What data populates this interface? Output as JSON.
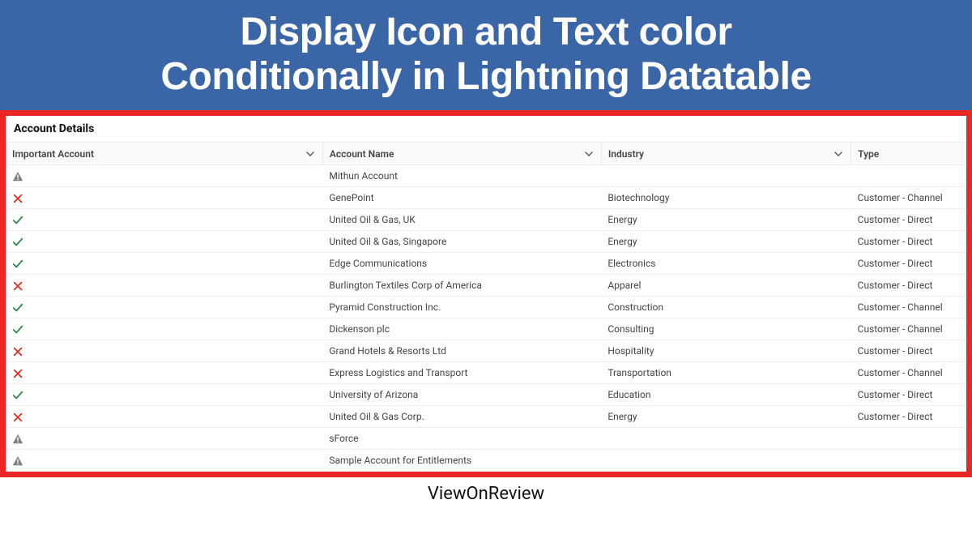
{
  "banner": {
    "title_line1": "Display Icon and Text color",
    "title_line2": "Conditionally in Lightning Datatable"
  },
  "card": {
    "title": "Account Details"
  },
  "columns": {
    "important": "Important Account",
    "name": "Account Name",
    "industry": "Industry",
    "type": "Type"
  },
  "rows": [
    {
      "icon": "warning",
      "color": "default",
      "name": "Mithun Account",
      "industry": "",
      "type": ""
    },
    {
      "icon": "close",
      "color": "red",
      "name": "GenePoint",
      "industry": "Biotechnology",
      "type": "Customer - Channel"
    },
    {
      "icon": "check",
      "color": "green",
      "name": "United Oil & Gas, UK",
      "industry": "Energy",
      "type": "Customer - Direct"
    },
    {
      "icon": "check",
      "color": "green",
      "name": "United Oil & Gas, Singapore",
      "industry": "Energy",
      "type": "Customer - Direct"
    },
    {
      "icon": "check",
      "color": "green",
      "name": "Edge Communications",
      "industry": "Electronics",
      "type": "Customer - Direct"
    },
    {
      "icon": "close",
      "color": "red",
      "name": "Burlington Textiles Corp of America",
      "industry": "Apparel",
      "type": "Customer - Direct"
    },
    {
      "icon": "check",
      "color": "green",
      "name": "Pyramid Construction Inc.",
      "industry": "Construction",
      "type": "Customer - Channel"
    },
    {
      "icon": "check",
      "color": "green",
      "name": "Dickenson plc",
      "industry": "Consulting",
      "type": "Customer - Channel"
    },
    {
      "icon": "close",
      "color": "red",
      "name": "Grand Hotels & Resorts Ltd",
      "industry": "Hospitality",
      "type": "Customer - Direct"
    },
    {
      "icon": "close",
      "color": "red",
      "name": "Express Logistics and Transport",
      "industry": "Transportation",
      "type": "Customer - Channel"
    },
    {
      "icon": "check",
      "color": "green",
      "name": "University of Arizona",
      "industry": "Education",
      "type": "Customer - Direct"
    },
    {
      "icon": "close",
      "color": "red",
      "name": "United Oil & Gas Corp.",
      "industry": "Energy",
      "type": "Customer - Direct"
    },
    {
      "icon": "warning",
      "color": "default",
      "name": "sForce",
      "industry": "",
      "type": ""
    },
    {
      "icon": "warning",
      "color": "default",
      "name": "Sample Account for Entitlements",
      "industry": "",
      "type": ""
    }
  ],
  "footer": {
    "text": "ViewOnReview"
  },
  "colors": {
    "red": "#d93025",
    "green": "#2e844a",
    "default": "#444"
  }
}
